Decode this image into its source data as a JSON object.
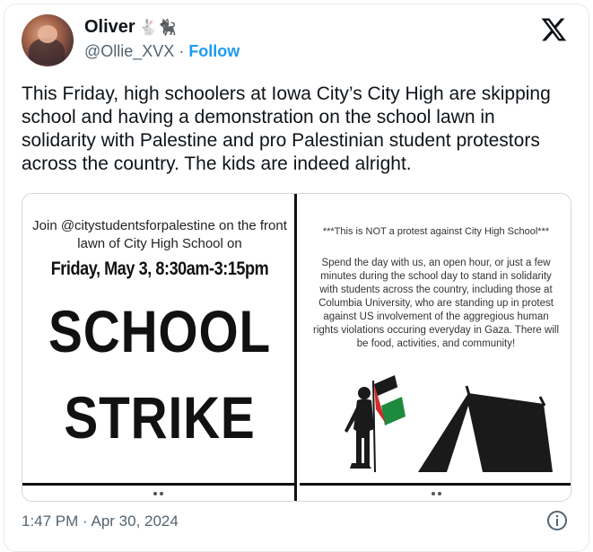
{
  "author": {
    "name": "Oliver",
    "name_emoji": "🐇🐈‍⬛",
    "handle": "@Ollie_XVX",
    "separator": "·",
    "follow_label": "Follow"
  },
  "brand_logo": "x-logo-icon",
  "tweet_text": "This Friday, high schoolers at Iowa City’s City High are skipping school and having a demonstration on the school lawn in solidarity with Palestine and pro Palestinian student protestors across the country. The kids are indeed alright.",
  "media": {
    "left": {
      "intro_line1": "Join @citystudentsforpalestine on the front",
      "intro_line2": "lawn of City High School on",
      "date_line": "Friday, May 3, 8:30am-3:15pm",
      "headline1": "SCHOOL",
      "headline2": "STRIKE"
    },
    "right": {
      "title": "***This is NOT a protest against City High School***",
      "body": "Spend the day with us, an open hour, or just a few minutes during the school day to stand in solidarity with students across the country, including those at Columbia University, who are standing up in protest against US involvement of the aggregious human rights violations occuring everyday in Gaza. There will be food, activities, and community!"
    }
  },
  "timestamp": "1:47 PM · Apr 30, 2024",
  "colors": {
    "accent": "#1d9bf0",
    "text": "#0f1419",
    "muted": "#536471",
    "flag_green": "#1e8a3e",
    "flag_red": "#d42a2a"
  }
}
